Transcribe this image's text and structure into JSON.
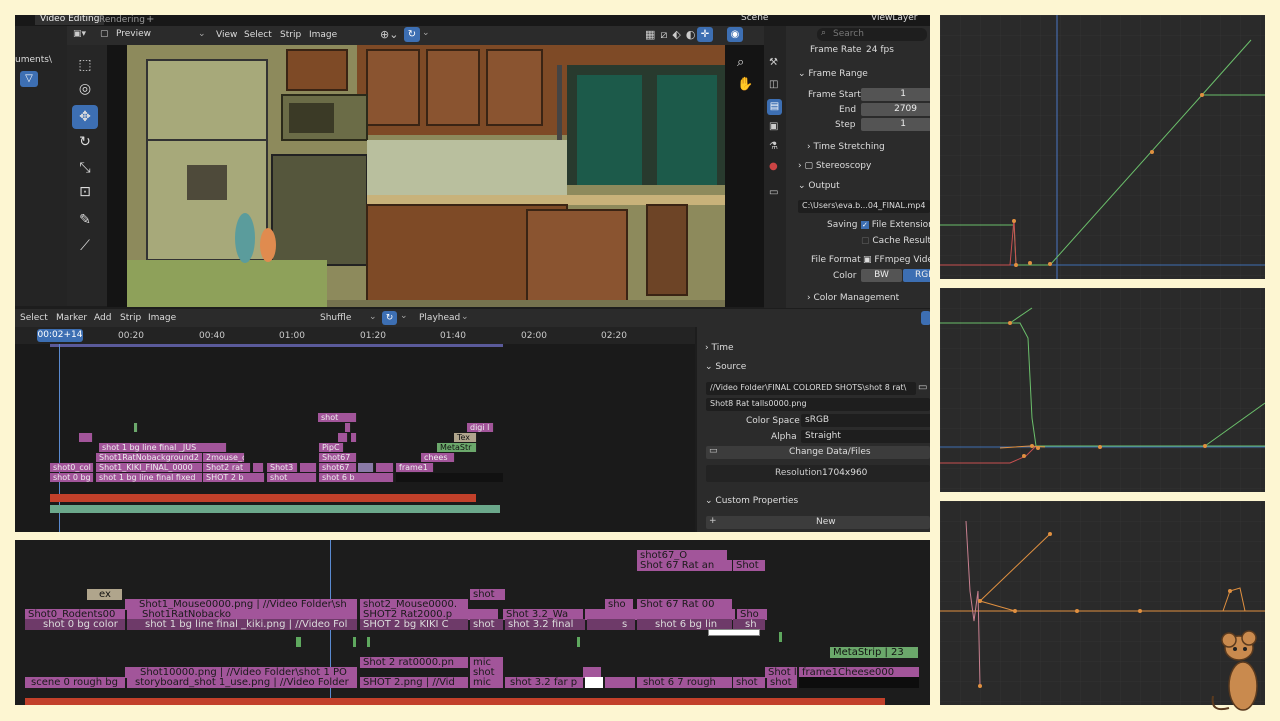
{
  "tabs": {
    "video_editing": "Video Editing",
    "rendering": "Rendering",
    "add": "+",
    "scene": "Scene",
    "view_layer": "ViewLayer"
  },
  "filebrowser": {
    "path": "uments\\"
  },
  "preview_header": {
    "mode": "Preview",
    "view": "View",
    "select": "Select",
    "strip": "Strip",
    "image": "Image"
  },
  "props": {
    "search_placeholder": "Search",
    "frame_rate_label": "Frame Rate",
    "frame_rate": "24 fps",
    "frame_range": "Frame Range",
    "frame_start_label": "Frame Start",
    "frame_start": "1",
    "end_label": "End",
    "end": "2709",
    "step_label": "Step",
    "step": "1",
    "time_stretching": "Time Stretching",
    "stereoscopy": "Stereoscopy",
    "output": "Output",
    "output_path": "C:\\Users\\eva.b...04_FINAL.mp4",
    "saving_label": "Saving",
    "file_extensions": "File Extensions",
    "cache_result": "Cache Result",
    "file_format_label": "File Format",
    "file_format": "FFmpeg Video",
    "color_label": "Color",
    "bw": "BW",
    "rgb": "RGB",
    "color_management": "Color Management"
  },
  "seq_header": {
    "select": "Select",
    "marker": "Marker",
    "add": "Add",
    "strip": "Strip",
    "image": "Image",
    "shuffle": "Shuffle",
    "playhead": "Playhead"
  },
  "timeline": {
    "current": "00:02+14",
    "ticks": [
      "00:20",
      "00:40",
      "01:00",
      "01:20",
      "01:40",
      "02:00",
      "02:20"
    ]
  },
  "sidebar": {
    "time": "Time",
    "source": "Source",
    "directory": "//Video Folder\\FINAL COLORED SHOTS\\shot 8 rat\\",
    "file": "Shot8 Rat talls0000.png",
    "color_space_label": "Color Space",
    "color_space": "sRGB",
    "alpha_label": "Alpha",
    "alpha": "Straight",
    "change_data": "Change Data/Files",
    "resolution_label": "Resolution",
    "resolution": "1704x960",
    "custom_properties": "Custom Properties",
    "new": "New"
  },
  "strips": {
    "shot": "shot",
    "digi": "digi l",
    "tex": "Tex",
    "metastr": "MetaStr",
    "chees": "chees",
    "pipc": "PipC",
    "bgfinal": "shot 1 bg line final _JUS",
    "ratnobg": "Shot1RatNobackground2",
    "mouse2": "2mouse_c",
    "shot67a": "Shot67",
    "shot67b": "shot67",
    "shot3": "Shot3",
    "shot2rat": "Shot2 rat",
    "col0": "shot0_col",
    "kiki": "Shot1_KIKI_FINAL_0000",
    "frame1": "frame1",
    "bg0": "shot 0 bg",
    "bgfixed": "shot 1 bg line final fixed",
    "shot2b": "SHOT 2 b",
    "shotsm": "shot",
    "shot6b": "shot 6 b"
  },
  "bottom": {
    "shot67o": "shot67_O",
    "shot67rat": "Shot 67 Rat an",
    "shot_r": "Shot",
    "ex": "ex",
    "mouse0000": "Shot1_Mouse0000.png | //Video Folder\\sh",
    "shot2mouse": "shot2_Mouse0000.",
    "shot_b": "shot",
    "sho": "sho",
    "shot67rat00": "Shot 67 Rat 00",
    "rodents": "Shot0_Rodents00",
    "ratnoback": "Shot1RatNobacko",
    "rat2000": "SHOT2 Rat2000.p",
    "shot32wa": "Shot 3.2_Wa",
    "sho2": "Sho",
    "bg0color": "shot 0 bg color",
    "bg1kiki": "shot 1 bg line final _kiki.png | //Video Fol",
    "bg2kiki": "SHOT 2 bg KIKI C",
    "shotc": "shot",
    "shot32final": "shot 3.2 final",
    "s": "s",
    "shot6bglin": "shot 6 bg lin",
    "sh": "sh",
    "metastrip": "MetaStrip | 23",
    "rat0000": "Shot 2 rat0000.pn",
    "mic": "mic",
    "s10000": "Shot10000.png | //Video Folder\\shot 1 PO",
    "shot_d": "shot",
    "shotl": "Shot l",
    "frame1cheese": "frame1Cheese000",
    "rough0": "scene 0 rough bg",
    "storyboard": "storyboard_shot 1_use.png | //Video Folder",
    "shot2png": "SHOT 2.png | //Vid",
    "mic2": "mic",
    "shot32far": "shot 3.2 far p",
    "shot67rough": "shot 6 7 rough",
    "shot_e": "shot",
    "shot_f": "shot"
  }
}
